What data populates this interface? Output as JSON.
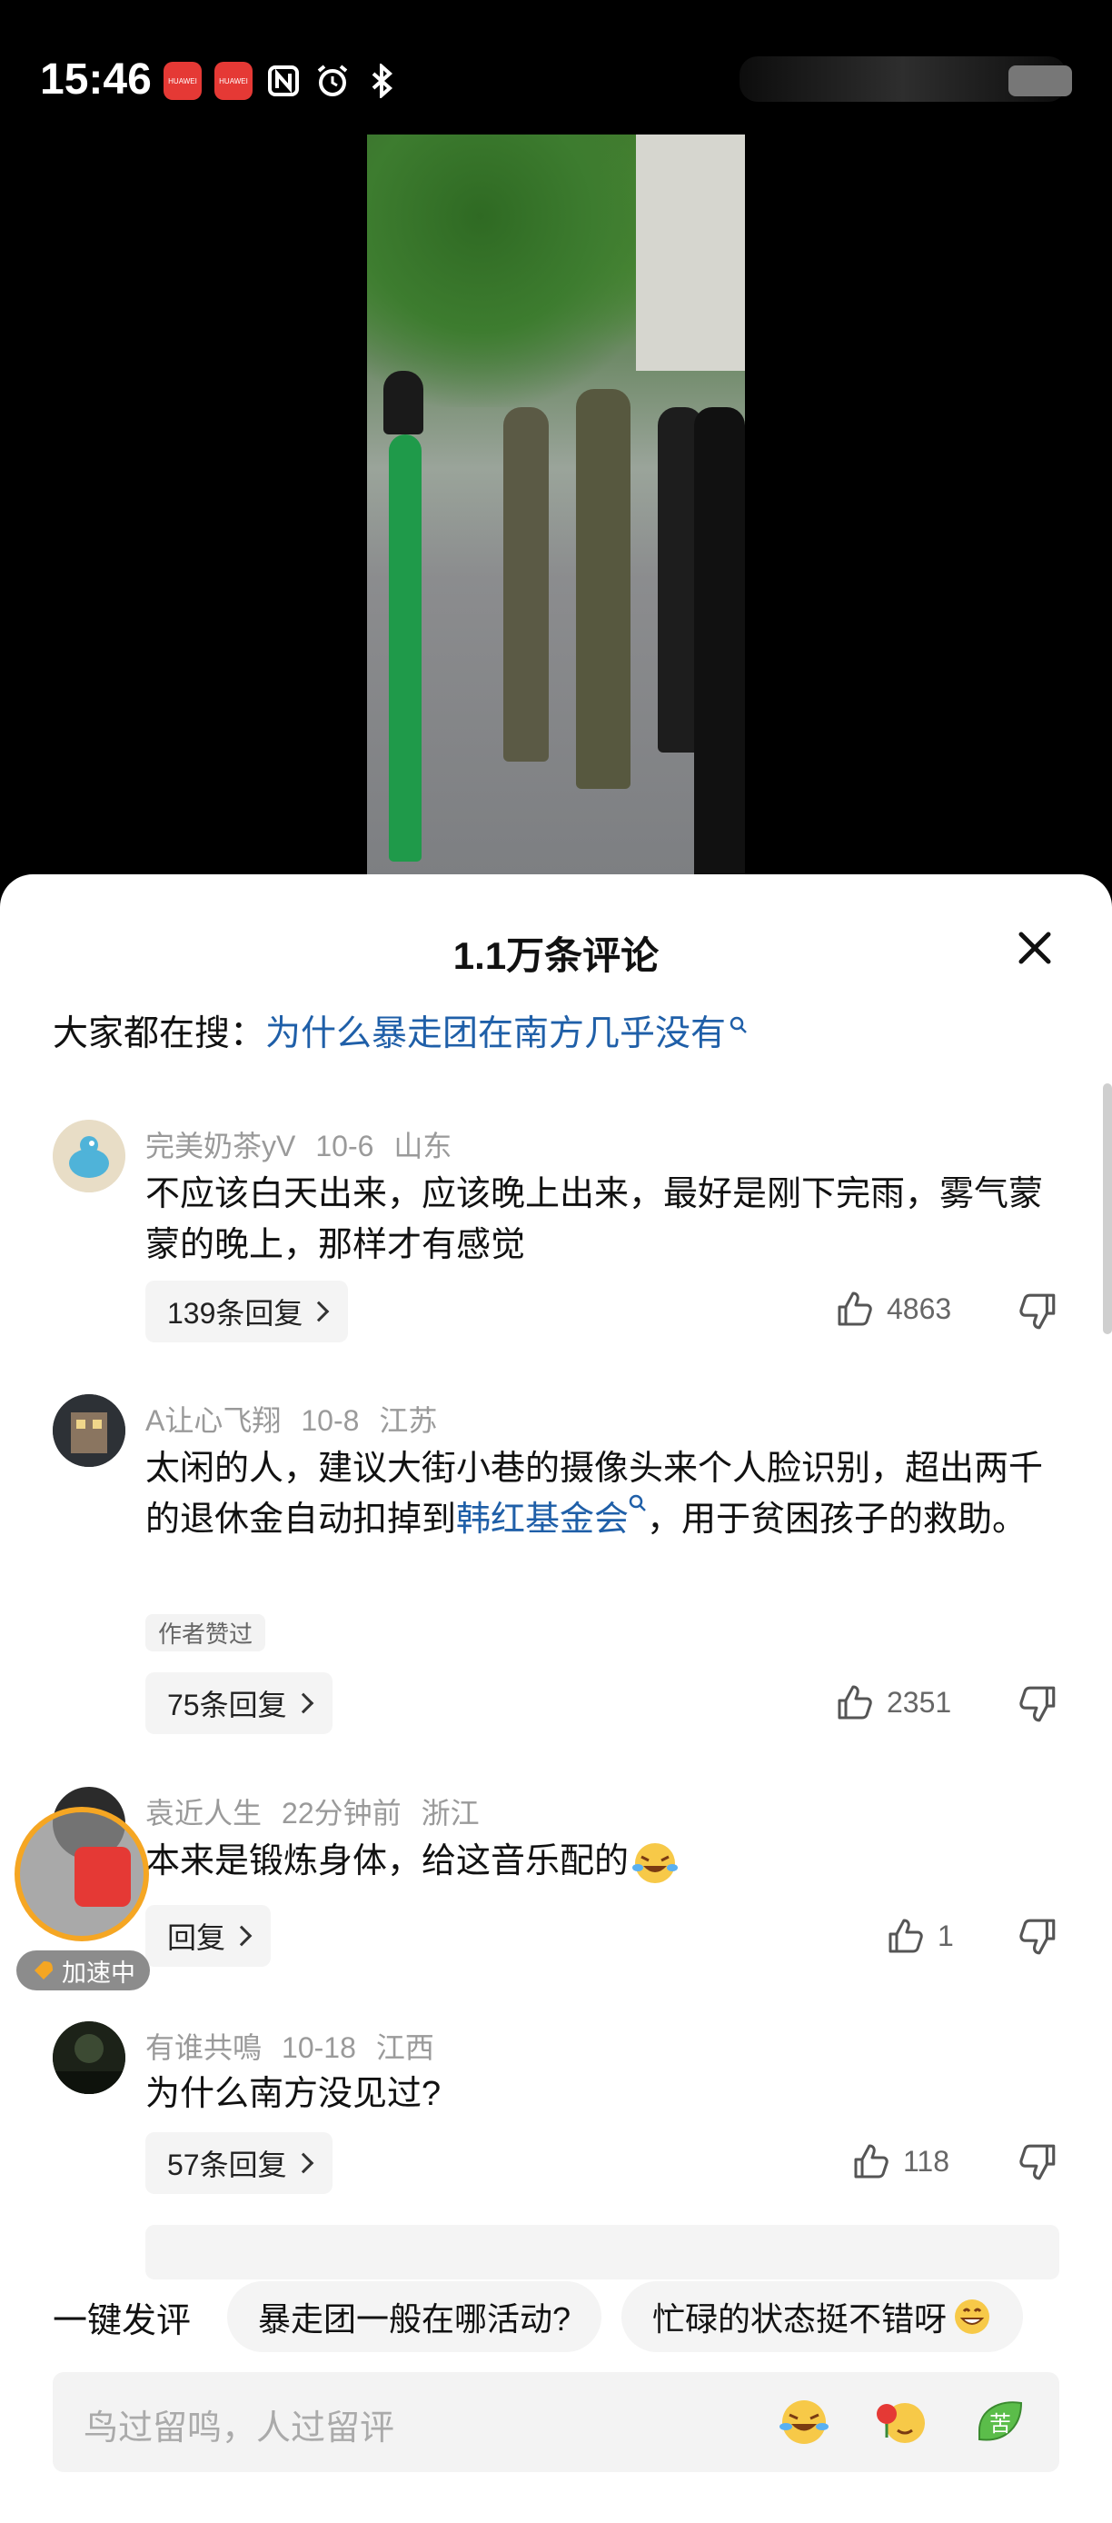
{
  "status_bar": {
    "time": "15:46",
    "icons": [
      "huawei-app-icon",
      "huawei-app-icon",
      "nfc-icon",
      "alarm-icon",
      "bluetooth-icon"
    ],
    "app_badge_text": "HUAWEI"
  },
  "sheet": {
    "title": "1.1万条评论",
    "search_prefix": "大家都在搜：",
    "search_link": "为什么暴走团在南方几乎没有"
  },
  "comments": [
    {
      "user": "完美奶茶yV",
      "date": "10-6",
      "location": "山东",
      "text": "不应该白天出来，应该晚上出来，最好是刚下完雨，雾气蒙蒙的晚上，那样才有感觉",
      "replies": "139条回复",
      "likes": "4863"
    },
    {
      "user": "A让心飞翔",
      "date": "10-8",
      "location": "江苏",
      "text_before": "太闲的人，建议大街小巷的摄像头来个人脸识别，超出两千的退休金自动扣掉到",
      "text_link": "韩红基金会",
      "text_after": "，用于贫困孩子的救助。",
      "tag": "作者赞过",
      "replies": "75条回复",
      "likes": "2351"
    },
    {
      "user": "袁近人生",
      "date": "22分钟前",
      "location": "浙江",
      "text": "本来是锻炼身体，给这音乐配的",
      "replies": "回复",
      "likes": "1"
    },
    {
      "user": "有谁共鳴",
      "date": "10-18",
      "location": "江西",
      "text": "为什么南方没见过?",
      "replies": "57条回复",
      "likes": "118"
    }
  ],
  "floating_widget": {
    "label": "加速中"
  },
  "quick_comments": {
    "label": "一键发评",
    "options": [
      "暴走团一般在哪活动?",
      "忙碌的状态挺不错呀"
    ]
  },
  "input": {
    "placeholder": "鸟过留鸣，人过留评",
    "emoji_3_text": "苦"
  }
}
